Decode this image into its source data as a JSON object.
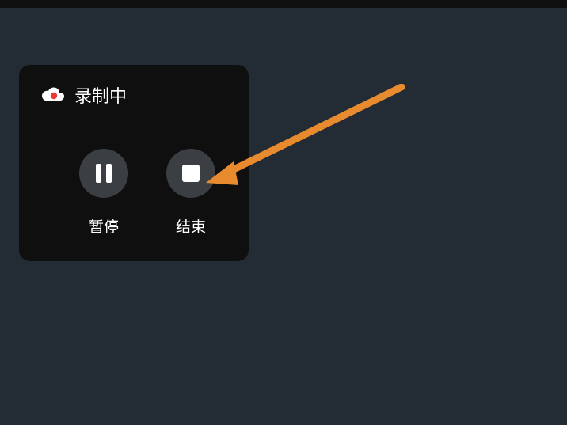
{
  "panel": {
    "title": "录制中",
    "pause_label": "暂停",
    "stop_label": "结束"
  },
  "colors": {
    "arrow": "#e88a2e",
    "record_dot": "#ef3636"
  }
}
